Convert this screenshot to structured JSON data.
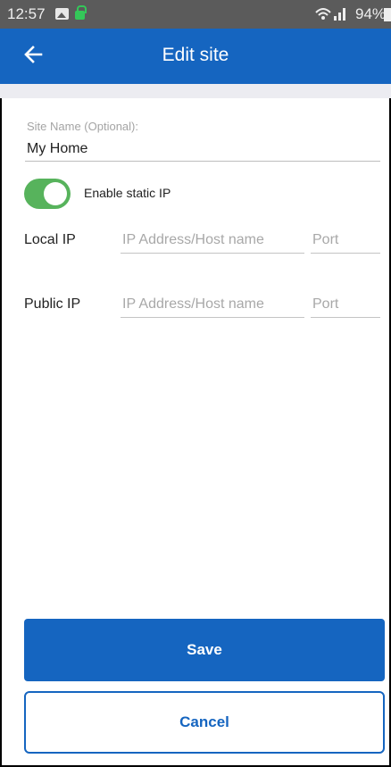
{
  "status_bar": {
    "time": "12:57",
    "signal_text": "‧‧∶∣",
    "battery_percent": "94%",
    "icons": [
      "gallery-icon",
      "lock-icon",
      "wifi-icon",
      "signal-icon",
      "battery-icon"
    ]
  },
  "app_bar": {
    "title": "Edit site",
    "back_icon": "arrow-left-icon"
  },
  "site_name": {
    "label": "Site Name (Optional):",
    "value": "My Home"
  },
  "static_ip": {
    "label": "Enable static IP",
    "enabled": true
  },
  "local_ip": {
    "label": "Local IP",
    "address_placeholder": "IP Address/Host name",
    "port_placeholder": "Port"
  },
  "public_ip": {
    "label": "Public IP",
    "address_placeholder": "IP Address/Host name",
    "port_placeholder": "Port"
  },
  "actions": {
    "save_label": "Save",
    "cancel_label": "Cancel"
  },
  "colors": {
    "primary": "#1565c0",
    "toggle_on": "#57b35c",
    "status_bar": "#5b5b5b"
  }
}
